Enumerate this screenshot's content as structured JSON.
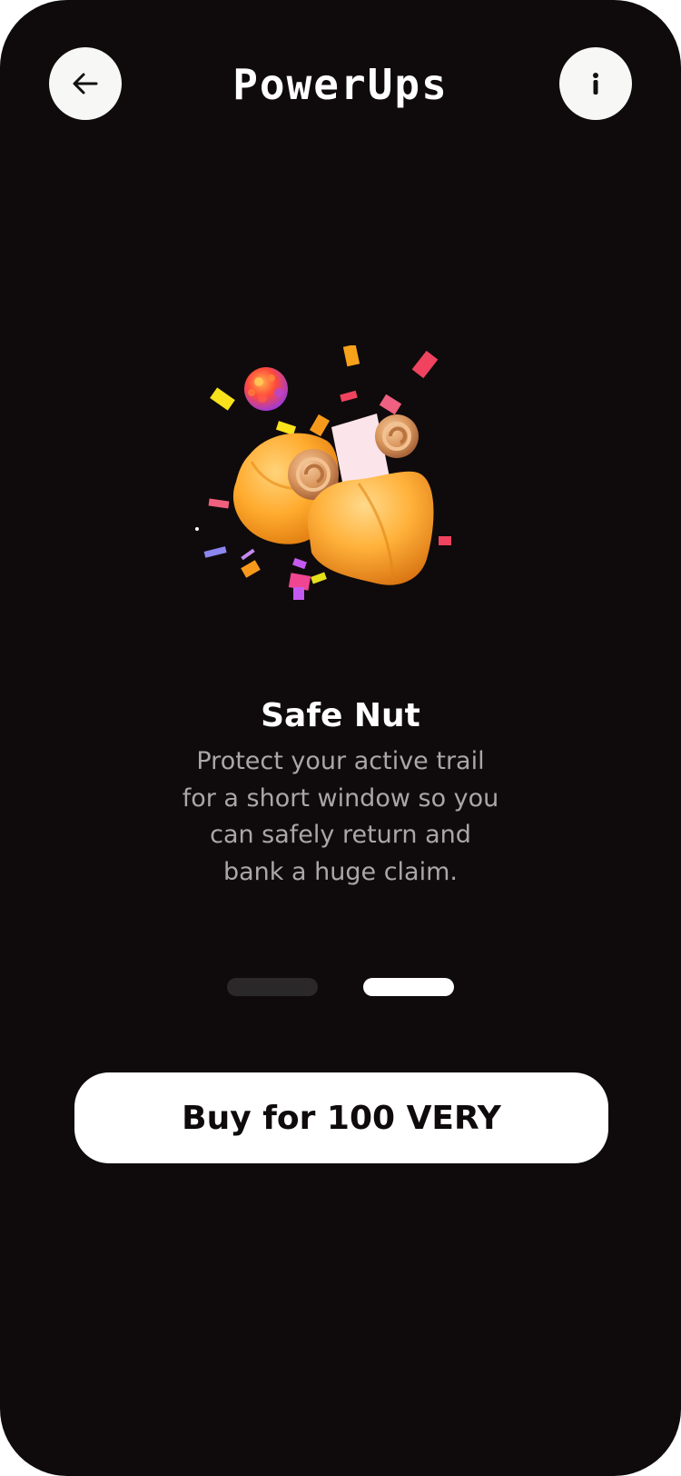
{
  "header": {
    "title": "PowerUps",
    "back_icon": "arrow-left-icon",
    "info_icon": "info-icon"
  },
  "item": {
    "image": "fortune-cookie-with-coins-and-confetti",
    "name": "Safe Nut",
    "description": "Protect your active trail for a short window so you can safely return and bank a huge claim."
  },
  "pager": {
    "total": 2,
    "active_index": 2
  },
  "cta": {
    "label": "Buy for 100 VERY"
  },
  "colors": {
    "background": "#0f0b0c",
    "button": "#ffffff",
    "text_primary": "#ffffff",
    "text_secondary": "#a9a7a7",
    "pager_inactive": "#2a2829",
    "pager_active": "#ffffff",
    "accent_orange": "#f7a21b"
  }
}
